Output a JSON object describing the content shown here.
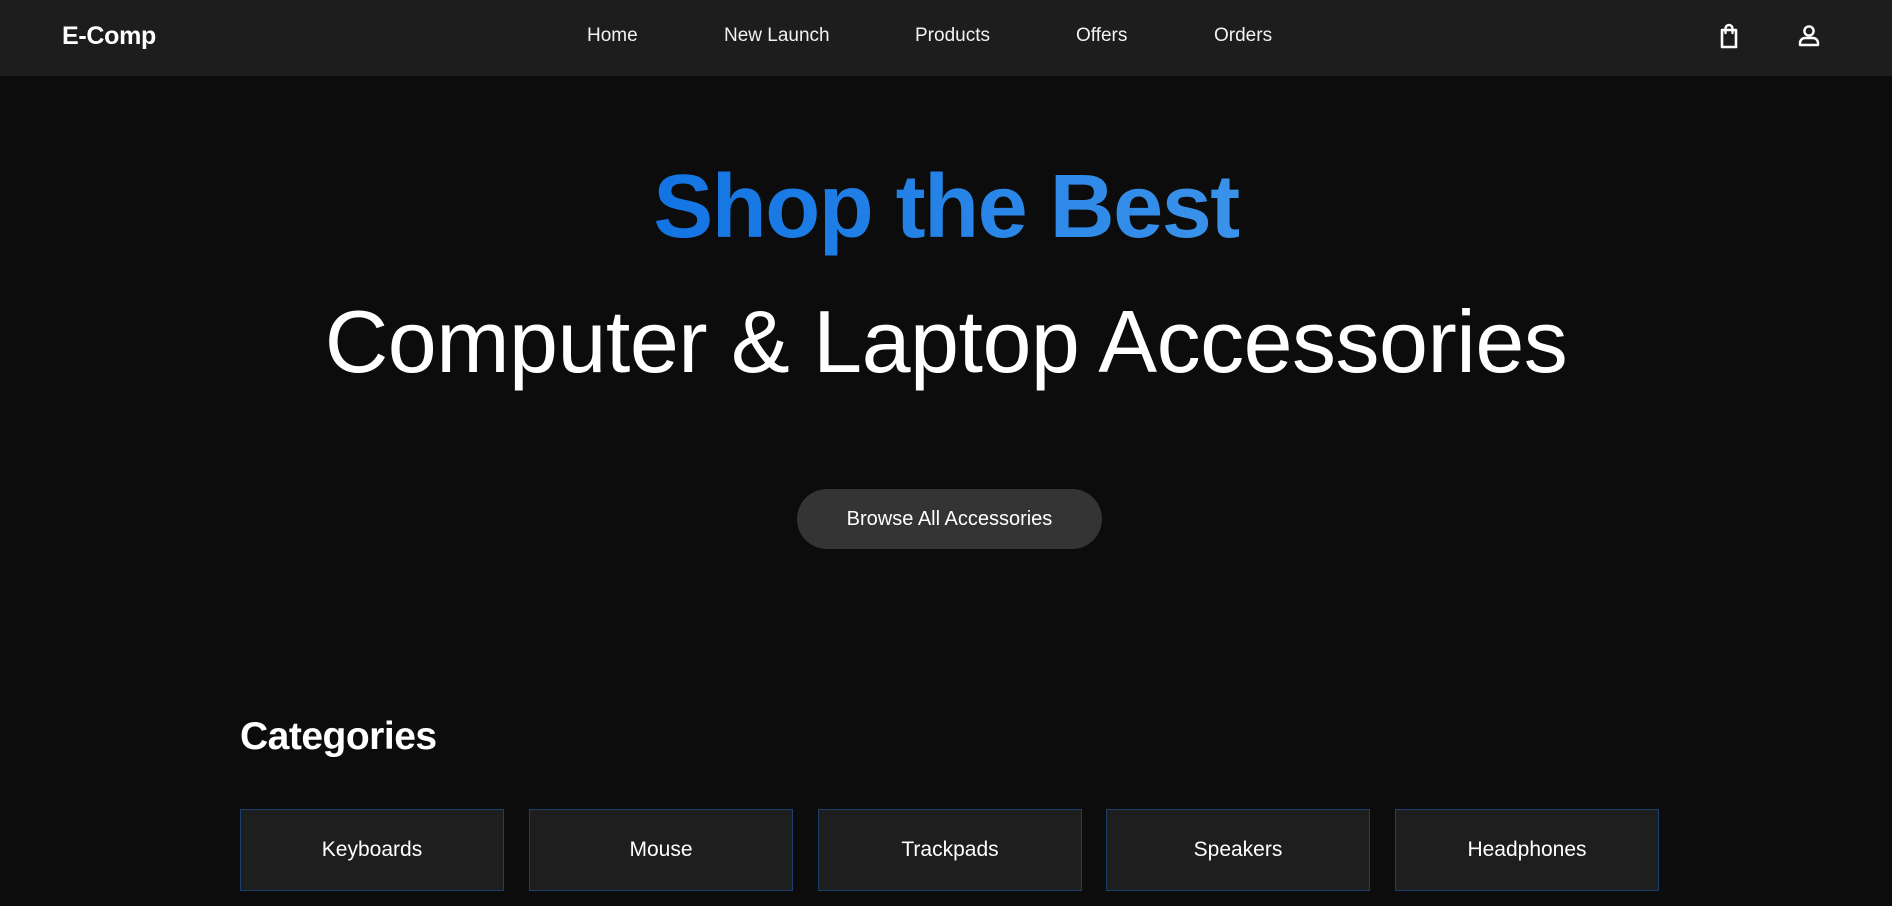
{
  "navbar": {
    "brand": "E-Comp",
    "links": [
      "Home",
      "New Launch",
      "Products",
      "Offers",
      "Orders"
    ],
    "icons": [
      "shopping-bag-icon",
      "user-icon"
    ]
  },
  "hero": {
    "headline": "Shop the Best",
    "subheadline": "Computer & Laptop Accessories",
    "cta_label": "Browse All Accessories"
  },
  "categories": {
    "title": "Categories",
    "items": [
      "Keyboards",
      "Mouse",
      "Trackpads",
      "Speakers",
      "Headphones"
    ]
  },
  "colors": {
    "background": "#0c0c0c",
    "navbar": "#1d1d1d",
    "accent_gradient_start": "#1274e3",
    "accent_gradient_end": "#3a92ea",
    "button": "#343434",
    "card": "#1e1e1e",
    "card_border": "#1c3f6e"
  }
}
